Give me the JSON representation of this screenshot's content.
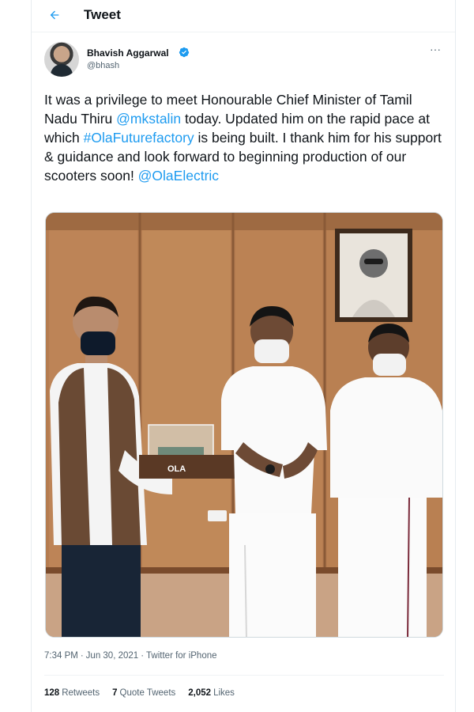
{
  "header": {
    "back_icon": "arrow-left-icon",
    "title": "Tweet"
  },
  "author": {
    "name": "Bhavish Aggarwal",
    "handle": "@bhash",
    "verified_icon": "verified-badge-icon",
    "more_icon": "more-dots-icon",
    "more_label": "···"
  },
  "tweet": {
    "text_1": "It was a privilege to meet Honourable Chief Minister of Tamil Nadu Thiru ",
    "mention_1": "@mkstalin",
    "text_2": " today. Updated him on the rapid pace at which ",
    "hashtag": "#OlaFuturefactory",
    "text_3": " is being built. I thank him for his support & guidance and look forward to beginning production of our scooters soon! ",
    "mention_2": "@OlaElectric"
  },
  "photo": {
    "box_label": "OLA"
  },
  "meta": {
    "time": "7:34 PM",
    "separator": "·",
    "date": "Jun 30, 2021",
    "source": "Twitter for iPhone"
  },
  "stats": {
    "retweets_count": "128",
    "retweets_label": "Retweets",
    "quotes_count": "7",
    "quotes_label": "Quote Tweets",
    "likes_count": "2,052",
    "likes_label": "Likes"
  },
  "colors": {
    "link": "#1d9bf0",
    "text": "#0f1419",
    "secondary": "#536471",
    "border": "#eff3f4"
  }
}
